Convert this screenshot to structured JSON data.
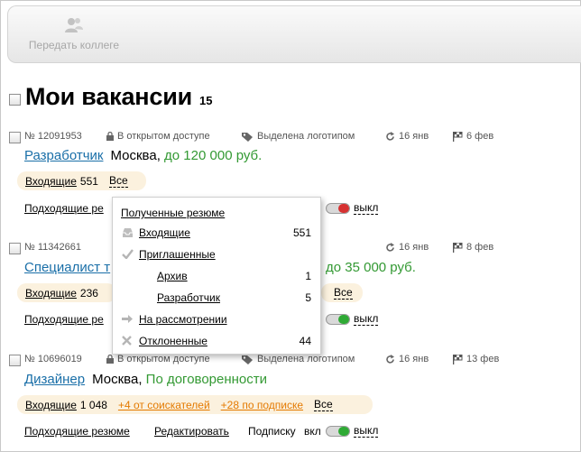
{
  "toolbar": {
    "share_label": "Передать коллеге",
    "share_icon": "users-icon"
  },
  "heading": {
    "title": "Мои вакансии",
    "count": "15"
  },
  "vacancies": [
    {
      "id": "№ 12091953",
      "access": "В открытом доступе",
      "promo": "Выделена логотипом",
      "updated": "16 янв",
      "expires": "6 фев",
      "title": "Разработчик",
      "city": "Москва,",
      "salary": "до 120 000 руб.",
      "incoming_label": "Входящие",
      "incoming_count": "551",
      "all_label": "Все",
      "suitable_label": "Подходящие ре",
      "sub_state": "выкл"
    },
    {
      "id": "№ 11342661",
      "access": "",
      "promo": "",
      "updated": "16 янв",
      "expires": "8 фев",
      "title": "Специалист т",
      "city": "",
      "salary": "до 35 000 руб.",
      "incoming_label": "Входящие",
      "incoming_count": "236",
      "all_label": "Все",
      "suitable_label": "Подходящие ре",
      "sub_state": "выкл"
    },
    {
      "id": "№ 10696019",
      "access": "В открытом доступе",
      "promo": "Выделена логотипом",
      "updated": "16 янв",
      "expires": "13 фев",
      "title": "Дизайнер",
      "city": "Москва,",
      "salary": "По договоренности",
      "incoming_label": "Входящие",
      "incoming_count": "1 048",
      "plus_applicants": "+4 от соискателей",
      "plus_subscription": "+28 по подписке",
      "all_label": "Все",
      "suitable_label": "Подходящие резюме",
      "edit_label": "Редактировать",
      "sub_label": "Подписку",
      "sub_on": "вкл",
      "sub_state": "выкл"
    }
  ],
  "popup": {
    "header": "Полученные резюме",
    "items": [
      {
        "icon": "inbox-icon",
        "label": "Входящие",
        "count": "551"
      },
      {
        "icon": "check-icon",
        "label": "Приглашенные",
        "count": ""
      },
      {
        "icon": "",
        "label": "Архив",
        "count": "1"
      },
      {
        "icon": "",
        "label": "Разработчик",
        "count": "5"
      },
      {
        "icon": "arrow-right-icon",
        "label": "На рассмотрении",
        "count": ""
      },
      {
        "icon": "cross-icon",
        "label": "Отклоненные",
        "count": "44"
      }
    ]
  },
  "colors": {
    "link": "#1a6fa8",
    "salary": "#339933",
    "accent_orange": "#e47a00",
    "pill_bg": "#fbf1de",
    "toggle_off": "#d63131",
    "toggle_on": "#2faa35"
  }
}
